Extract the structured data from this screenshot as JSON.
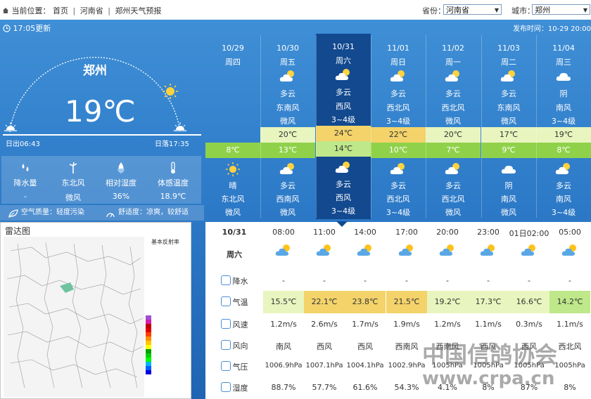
{
  "breadcrumb": {
    "icon": "home-icon",
    "label": "当前位置：",
    "items": [
      "首页",
      "河南省",
      "郑州天气预报"
    ]
  },
  "province": {
    "label": "省份：",
    "value": "河南省"
  },
  "city_select": {
    "label": "城市：",
    "value": "郑州"
  },
  "publish_time": "发布时间：10-29 20:00",
  "update_time": "17:05更新",
  "current": {
    "city": "郑州",
    "temperature": "19℃",
    "sunrise": "日出06:43",
    "sunset": "日落17:35"
  },
  "stats": [
    {
      "icon": "raindrop-icon",
      "label": "降水量",
      "value": "-"
    },
    {
      "icon": "wind-turbine-icon",
      "label": "东北风",
      "value": "微风"
    },
    {
      "icon": "humidity-icon",
      "label": "相对湿度",
      "value": "36%"
    },
    {
      "icon": "thermometer-icon",
      "label": "体感温度",
      "value": "18.9℃"
    }
  ],
  "air_quality": "空气质量：轻度污染",
  "comfort": "舒适度：凉爽，较舒适",
  "radar": {
    "title": "雷达图",
    "legend_title": "基本反射率"
  },
  "colors": {
    "high_warm": "#f3d36a",
    "high_mild": "#e8f5bf",
    "low_green": "#8fd24a",
    "selected": "#12498f"
  },
  "days": [
    {
      "date": "10/29",
      "week": "周四",
      "day_weather": "",
      "day_wind": "",
      "day_level": "",
      "day_icon": "",
      "high": "",
      "low": "8℃",
      "night_icon": "sun-icon",
      "night_weather": "晴",
      "night_wind": "东北风",
      "night_level": "微风"
    },
    {
      "date": "10/30",
      "week": "周五",
      "day_weather": "多云",
      "day_wind": "东南风",
      "day_level": "微风",
      "day_icon": "partly-cloudy-icon",
      "high": "20℃",
      "low": "13℃",
      "night_icon": "partly-cloudy-icon",
      "night_weather": "多云",
      "night_wind": "西南风",
      "night_level": "微风"
    },
    {
      "date": "10/31",
      "week": "周六",
      "day_weather": "多云",
      "day_wind": "西风",
      "day_level": "3~4级",
      "day_icon": "partly-cloudy-icon",
      "high": "24℃",
      "low": "14℃",
      "night_icon": "partly-cloudy-icon",
      "night_weather": "多云",
      "night_wind": "西风",
      "night_level": "3~4级"
    },
    {
      "date": "11/01",
      "week": "周日",
      "day_weather": "多云",
      "day_wind": "西北风",
      "day_level": "3~4级",
      "day_icon": "partly-cloudy-icon",
      "high": "22℃",
      "low": "10℃",
      "night_icon": "partly-cloudy-icon",
      "night_weather": "多云",
      "night_wind": "西北风",
      "night_level": "3~4级"
    },
    {
      "date": "11/02",
      "week": "周一",
      "day_weather": "多云",
      "day_wind": "西北风",
      "day_level": "微风",
      "day_icon": "partly-cloudy-icon",
      "high": "20℃",
      "low": "7℃",
      "night_icon": "partly-cloudy-icon",
      "night_weather": "多云",
      "night_wind": "西北风",
      "night_level": "微风"
    },
    {
      "date": "11/03",
      "week": "周二",
      "day_weather": "多云",
      "day_wind": "东南风",
      "day_level": "微风",
      "day_icon": "partly-cloudy-icon",
      "high": "17℃",
      "low": "9℃",
      "night_icon": "cloudy-icon",
      "night_weather": "阴",
      "night_wind": "南风",
      "night_level": "微风"
    },
    {
      "date": "11/04",
      "week": "周三",
      "day_weather": "阴",
      "day_wind": "南风",
      "day_level": "3~4级",
      "day_icon": "cloudy-icon",
      "high": "19℃",
      "low": "8℃",
      "night_icon": "partly-cloudy-icon",
      "night_weather": "多云",
      "night_wind": "南风",
      "night_level": "3~4级"
    }
  ],
  "hourly": {
    "date": "10/31",
    "week": "周六",
    "row_labels": [
      "降水",
      "气温",
      "风速",
      "风向",
      "气压",
      "湿度"
    ],
    "row_icons": [
      "rain-icon",
      "thermometer-icon",
      "wind-speed-icon",
      "wind-direction-icon",
      "pressure-icon",
      "humidity-icon"
    ],
    "columns": [
      {
        "time": "08:00",
        "icon": "partly-cloudy-icon",
        "rain": "-",
        "temp": "15.5℃",
        "speed": "1.2m/s",
        "dir": "南风",
        "pressure": "1006.9hPa",
        "humidity": "88.7%"
      },
      {
        "time": "11:00",
        "icon": "partly-cloudy-icon",
        "rain": "-",
        "temp": "22.1℃",
        "speed": "2.6m/s",
        "dir": "西风",
        "pressure": "1007.1hPa",
        "humidity": "57.7%"
      },
      {
        "time": "14:00",
        "icon": "partly-cloudy-icon",
        "rain": "-",
        "temp": "23.8℃",
        "speed": "1.7m/s",
        "dir": "西风",
        "pressure": "1004.1hPa",
        "humidity": "61.6%"
      },
      {
        "time": "17:00",
        "icon": "partly-cloudy-icon",
        "rain": "-",
        "temp": "21.5℃",
        "speed": "1.9m/s",
        "dir": "西南风",
        "pressure": "1002.9hPa",
        "humidity": "54.3%"
      },
      {
        "time": "20:00",
        "icon": "partly-cloudy-icon",
        "rain": "-",
        "temp": "19.2℃",
        "speed": "1.2m/s",
        "dir": "西南风",
        "pressure": "1005hPa",
        "humidity": "4.1%"
      },
      {
        "time": "23:00",
        "icon": "partly-cloudy-icon",
        "rain": "-",
        "temp": "17.3℃",
        "speed": "1.1m/s",
        "dir": "西风",
        "pressure": "1005hPa",
        "humidity": "8%"
      },
      {
        "time": "01日02:00",
        "icon": "partly-cloudy-icon",
        "rain": "-",
        "temp": "16.6℃",
        "speed": "0.3m/s",
        "dir": "西风",
        "pressure": "1005hPa",
        "humidity": "87%"
      },
      {
        "time": "05:00",
        "icon": "partly-cloudy-icon",
        "rain": "-",
        "temp": "14.2℃",
        "speed": "1.1m/s",
        "dir": "西北风",
        "pressure": "1005hPa",
        "humidity": "8%"
      }
    ]
  },
  "watermark": {
    "line1": "中国信鸽协会",
    "line2": "www.crpa.cn"
  }
}
